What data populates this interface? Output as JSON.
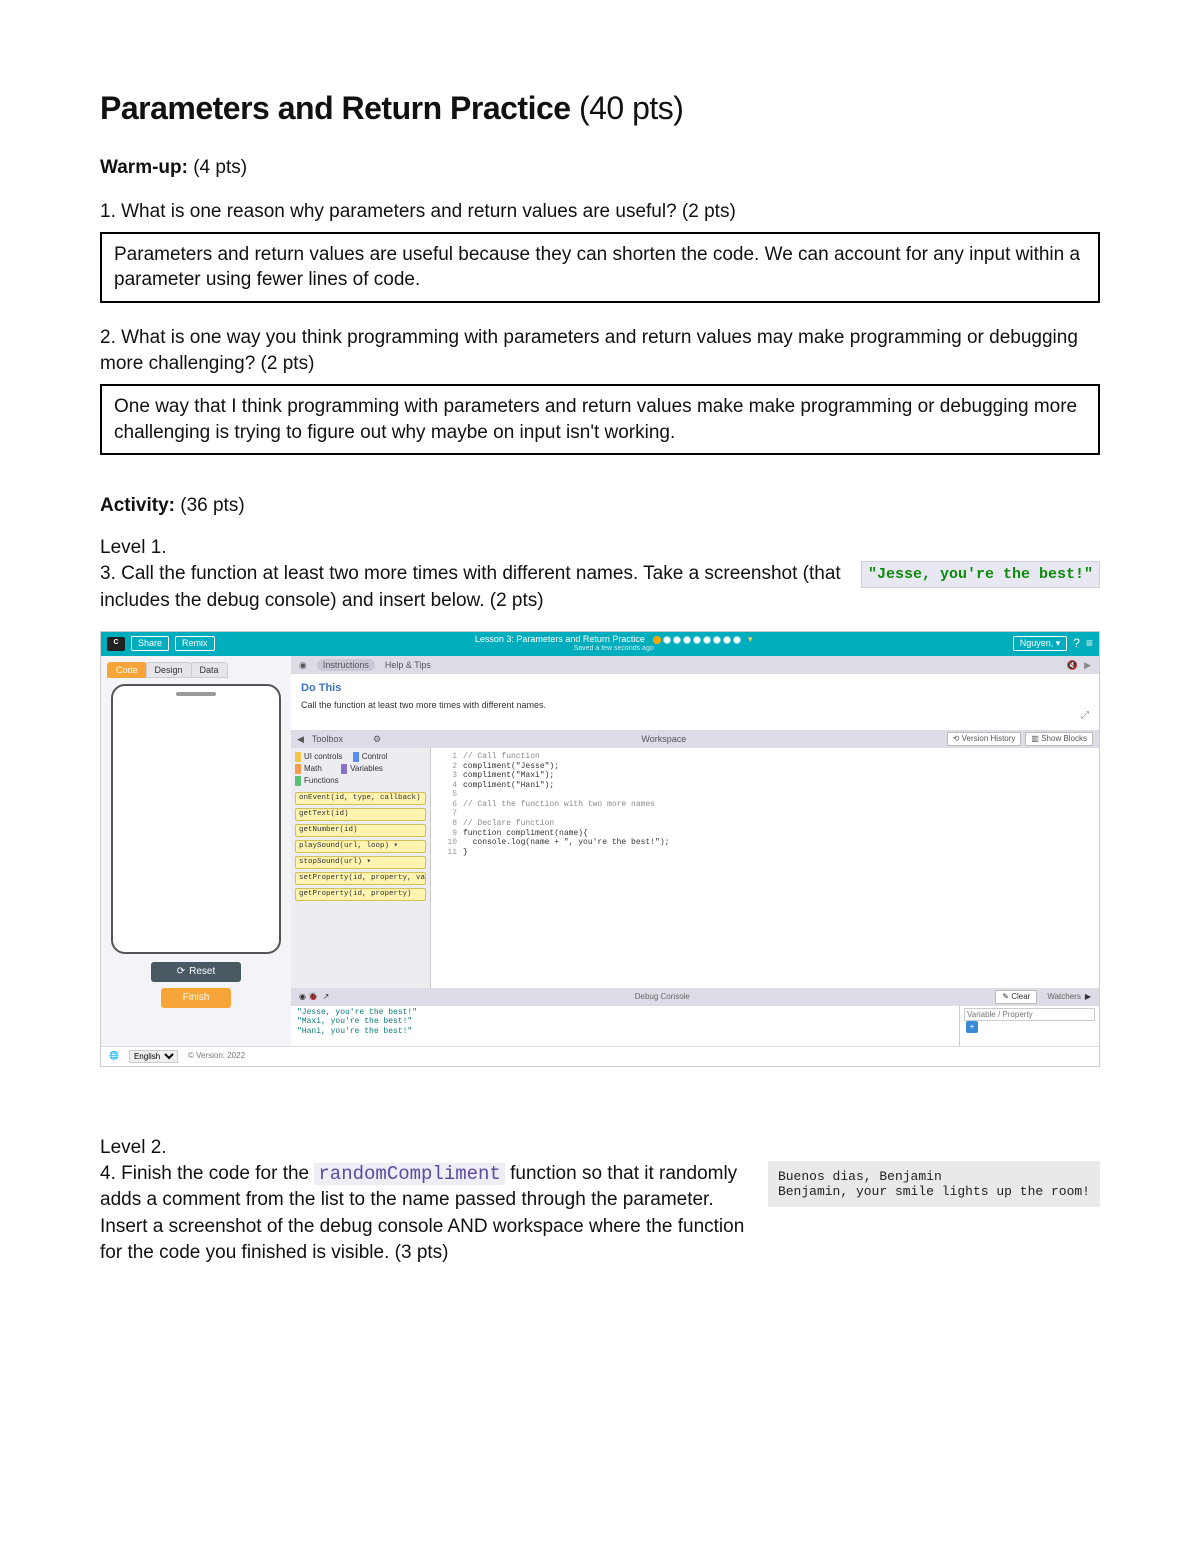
{
  "title_bold": "Parameters and Return Practice",
  "title_pts": "(40 pts)",
  "warmup_label": "Warm-up:",
  "warmup_pts": "(4 pts)",
  "q1_text": "1. What is one reason why parameters and return values are useful? (2 pts)",
  "q1_answer": "Parameters and return values are useful because they can shorten the code. We can account for any input within a parameter using fewer lines of code.",
  "q2_text": "2. What is one way you think programming with parameters and return values may make programming or debugging more challenging? (2 pts)",
  "q2_answer": "One way that I think programming with parameters and return values make make programming or debugging more challenging is trying to figure out why maybe on input isn't working.",
  "activity_label": "Activity:",
  "activity_pts": "(36 pts)",
  "level1_label": "Level 1.",
  "q3_text": "3. Call the function at least two more times with different names. Take a screenshot (that includes the debug console) and insert below. (2 pts)",
  "q3_quote": "\"Jesse, you're the best!\"",
  "ide": {
    "share": "Share",
    "remix": "Remix",
    "lesson_title": "Lesson 3: Parameters and Return Practice",
    "saved_hint": "Saved a few seconds ago",
    "more": "MORE",
    "user": "Nguyen, ▾",
    "tabs": {
      "code": "Code",
      "design": "Design",
      "data": "Data"
    },
    "reset": "Reset",
    "finish": "Finish",
    "instructions_tab": "Instructions",
    "help_tab": "Help & Tips",
    "do_this_title": "Do This",
    "do_this_text": "Call the function at least two more times with different names.",
    "toolbox_label": "Toolbox",
    "workspace_label": "Workspace",
    "version_history": "Version History",
    "show_blocks": "Show Blocks",
    "tb_cats": {
      "ui": "UI controls",
      "control": "Control",
      "math": "Math",
      "vars": "Variables",
      "fns": "Functions"
    },
    "tb_blocks": [
      "onEvent(id, type, callback)",
      "getText(id)",
      "getNumber(id)",
      "playSound(url, loop) ▾",
      "stopSound(url) ▾",
      "setProperty(id, property, va",
      "getProperty(id, property)"
    ],
    "code_lines": [
      {
        "n": "1",
        "cls": "c-comment",
        "t": "// Call function"
      },
      {
        "n": "2",
        "cls": "",
        "t": "compliment(\"Jesse\");"
      },
      {
        "n": "3",
        "cls": "",
        "t": "compliment(\"Maxi\");"
      },
      {
        "n": "4",
        "cls": "",
        "t": "compliment(\"Hani\");"
      },
      {
        "n": "5",
        "cls": "",
        "t": ""
      },
      {
        "n": "6",
        "cls": "c-comment",
        "t": "// Call the function with two more names"
      },
      {
        "n": "7",
        "cls": "",
        "t": ""
      },
      {
        "n": "8",
        "cls": "c-comment",
        "t": "// Declare function"
      },
      {
        "n": "9",
        "cls": "",
        "t": "function compliment(name){"
      },
      {
        "n": "10",
        "cls": "",
        "t": "  console.log(name + \", you're the best!\");"
      },
      {
        "n": "11",
        "cls": "",
        "t": "}"
      }
    ],
    "debug_label": "Debug Console",
    "clear": "Clear",
    "watchers": "Watchers",
    "watch_placeholder": "Variable / Property",
    "console_out": "\"Jesse, you're the best!\"\n\"Maxi, you're the best!\"\n\"Hani, you're the best!\"",
    "footer_lang": "English",
    "footer_version": "©  Version: 2022"
  },
  "level2_label": "Level 2.",
  "q4_pre": "4. Finish the code for the ",
  "q4_code": "randomCompliment",
  "q4_post": " function so that it randomly adds a comment from the list to the name passed through the parameter. Insert a screenshot of the debug console AND workspace where the function for the code you finished is visible. (3 pts)",
  "q4_console": "Buenos dias, Benjamin\nBenjamin, your smile lights up the room!"
}
